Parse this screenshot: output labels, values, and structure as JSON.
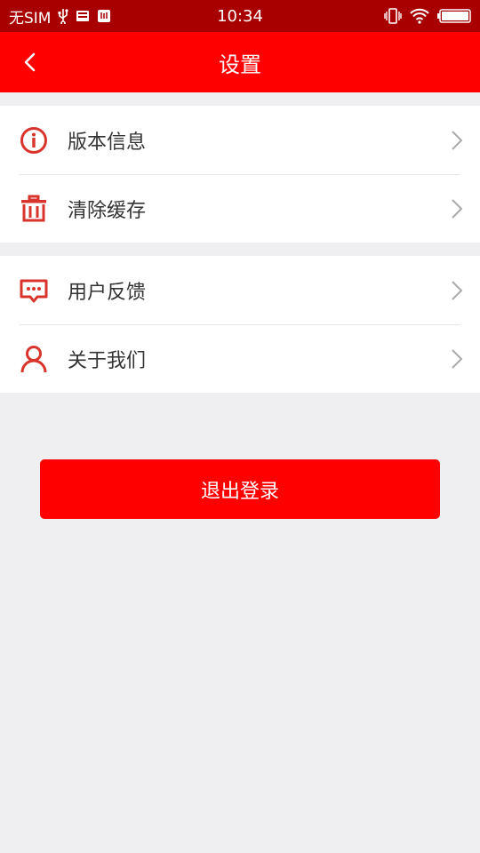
{
  "status_bar": {
    "carrier": "无SIM",
    "time": "10:34",
    "icons": [
      "usb-icon",
      "storage-icon",
      "debug-icon",
      "vibrate-icon",
      "wifi-icon",
      "battery-icon"
    ]
  },
  "nav": {
    "title": "设置",
    "back_icon": "chevron-left-icon"
  },
  "settings_groups": [
    {
      "items": [
        {
          "label": "版本信息",
          "icon": "info-icon"
        },
        {
          "label": "清除缓存",
          "icon": "trash-icon"
        }
      ]
    },
    {
      "items": [
        {
          "label": "用户反馈",
          "icon": "feedback-icon"
        },
        {
          "label": "关于我们",
          "icon": "user-icon"
        }
      ]
    }
  ],
  "logout": {
    "label": "退出登录"
  },
  "colors": {
    "status_bar": "#a80000",
    "nav_bar": "#ff0000",
    "icon": "#d9342b",
    "background": "#efeff1",
    "button": "#ff0000"
  }
}
